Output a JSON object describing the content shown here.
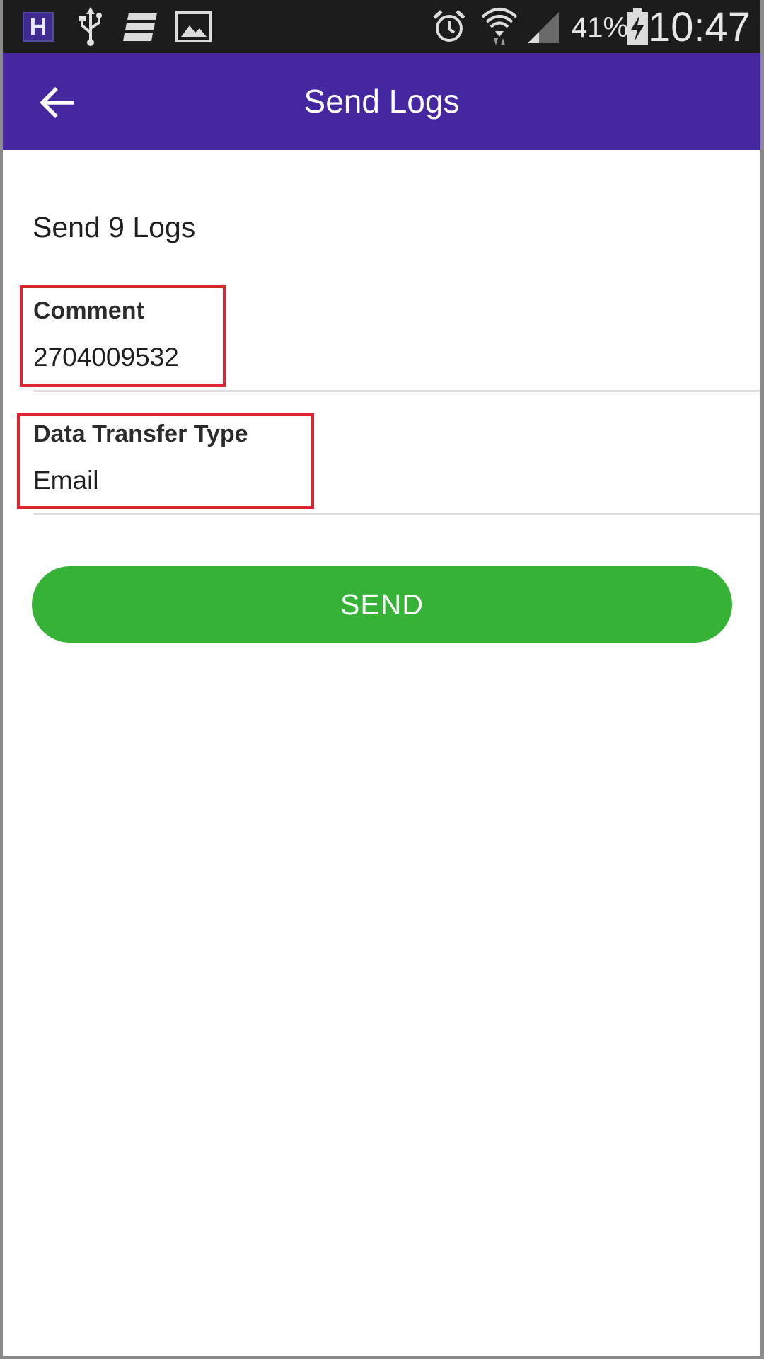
{
  "status_bar": {
    "app_badge": "H",
    "battery_percent": "41%",
    "time": "10:47",
    "icons": [
      "h-app-icon",
      "usb-icon",
      "storage-icon",
      "gallery-icon",
      "alarm-icon",
      "wifi-icon",
      "signal-icon",
      "battery-charging-icon"
    ]
  },
  "app_bar": {
    "title": "Send Logs",
    "back_icon": "arrow-back-icon",
    "color": "#4527a0"
  },
  "main": {
    "section_title": "Send 9 Logs",
    "fields": [
      {
        "label": "Comment",
        "value": "2704009532"
      },
      {
        "label": "Data Transfer Type",
        "value": "Email"
      }
    ],
    "send_label": "SEND",
    "send_color": "#36b336",
    "highlight_color": "#e0232e"
  }
}
